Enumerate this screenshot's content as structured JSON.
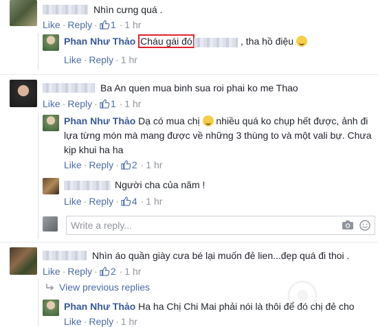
{
  "comments": [
    {
      "text": "Nhìn cưng quá .",
      "like_label": "Like",
      "reply_label": "Reply",
      "likes": "1",
      "time": "1 hr"
    },
    {
      "name": "Phan Như Thảo",
      "highlight": "Cháu gái đó",
      "text_after": ", tha hồ điệu",
      "like_label": "Like",
      "reply_label": "Reply",
      "time": "1 hr"
    },
    {
      "text": "Ba An quen mua binh sua roi phai ko me Thao",
      "like_label": "Like",
      "reply_label": "Reply",
      "likes": "1",
      "time": "1 hr"
    },
    {
      "name": "Phan Như Thảo",
      "line1_a": "Dạ có mua chị",
      "line1_b": "nhiều quá ko chụp hết được, ảnh đi",
      "line2": "lựa từng món mà mang được về những 3 thùng to và một vali bự. Chưa",
      "line3": "kịp khui ha ha",
      "like_label": "Like",
      "reply_label": "Reply",
      "likes": "2",
      "time": "1 hr"
    },
    {
      "text": "Người cha của năm !",
      "like_label": "Like",
      "reply_label": "Reply",
      "likes": "4",
      "time": "1 hr"
    },
    {
      "text": "Nhìn áo quần giày cưa bé lại muốn đẻ lien...đẹp quá đi thoi .",
      "like_label": "Like",
      "reply_label": "Reply",
      "likes": "2",
      "time": "1 hr"
    },
    {
      "name": "Phan Như Thảo",
      "text": "Ha ha Chị Chi Mai phải nói là thôi để đó chị đẻ cho",
      "like_label": "Like",
      "reply_label": "Reply",
      "time": "1 hr"
    }
  ],
  "reply_box": {
    "placeholder": "Write a reply..."
  },
  "view_previous": "View previous replies",
  "colors": {
    "link": "#365899",
    "meta": "#90949c",
    "highlight_border": "#e0212b"
  },
  "icons": [
    "thumbs-up-icon",
    "camera-icon",
    "sticker-icon",
    "reply-arrow-icon",
    "smile-emoji-icon",
    "laugh-emoji-icon"
  ]
}
